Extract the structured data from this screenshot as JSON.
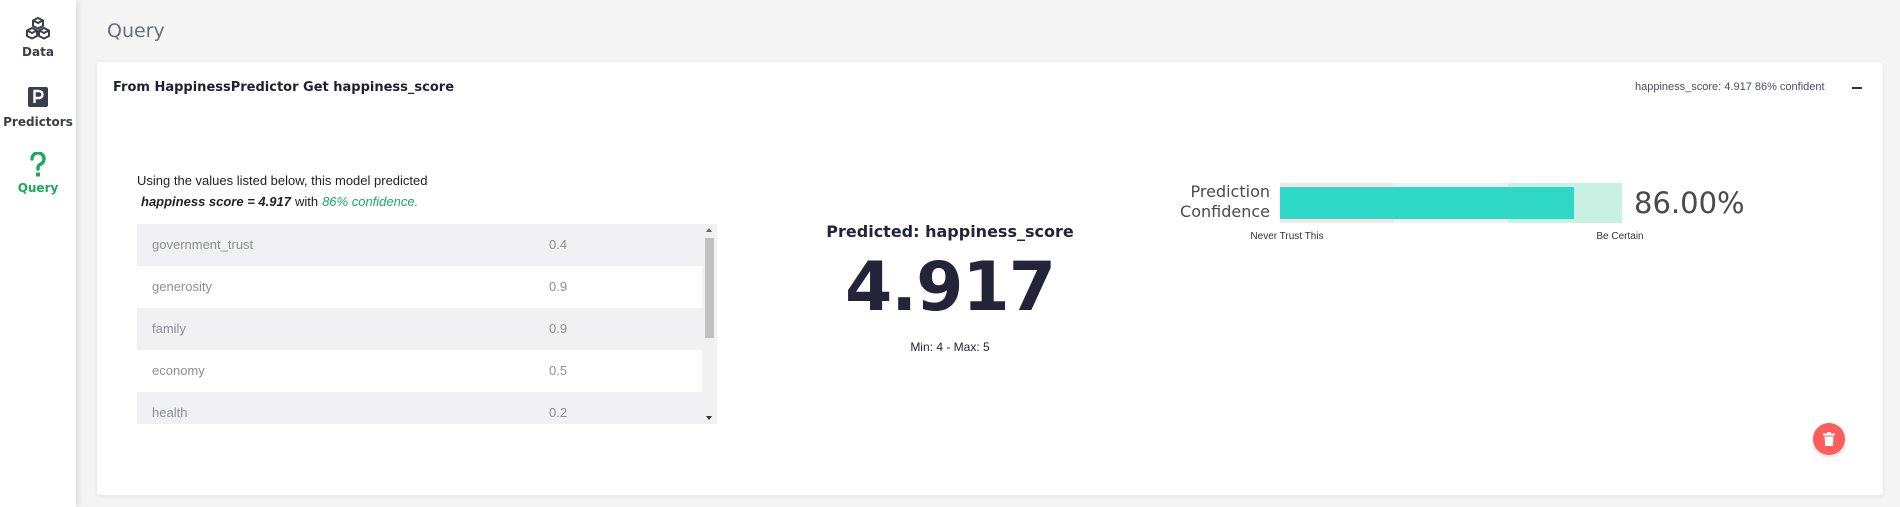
{
  "sidebar": {
    "items": [
      {
        "label": "Data",
        "icon": "cubes-icon",
        "active": false
      },
      {
        "label": "Predictors",
        "icon": "p-square-icon",
        "active": false
      },
      {
        "label": "Query",
        "icon": "question-icon",
        "active": true
      }
    ]
  },
  "page": {
    "title": "Query"
  },
  "card": {
    "title": "From HappinessPredictor Get happiness_score",
    "summary": "happiness_score: 4.917 86% confident",
    "intro_line1": "Using the values listed below, this model predicted",
    "intro_formula": "happiness score = 4.917",
    "intro_with": "with",
    "intro_confidence": "86% confidence.",
    "inputs": [
      {
        "name": "government_trust",
        "value": "0.4"
      },
      {
        "name": "generosity",
        "value": "0.9"
      },
      {
        "name": "family",
        "value": "0.9"
      },
      {
        "name": "economy",
        "value": "0.5"
      },
      {
        "name": "health",
        "value": "0.2"
      }
    ],
    "predicted_label": "Predicted: happiness_score",
    "predicted_value": "4.917",
    "predicted_range": "Min: 4 - Max: 5",
    "confidence": {
      "label_line1": "Prediction",
      "label_line2": "Confidence",
      "value": 0.86,
      "value_text": "86.00%",
      "min_label": "Never Trust This",
      "max_label": "Be Certain"
    }
  },
  "colors": {
    "accent_green": "#1aaa5e",
    "confidence_fill": "#2fd7c6",
    "delete_red": "#ff5c5c"
  }
}
